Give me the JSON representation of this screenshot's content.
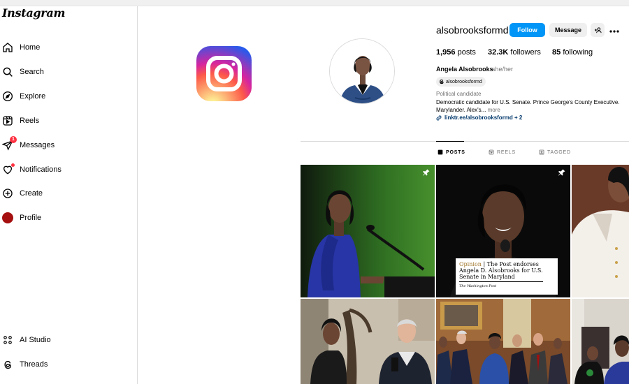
{
  "sidebar": {
    "brand": "Instagram",
    "items": [
      {
        "label": "Home",
        "icon": "home-icon"
      },
      {
        "label": "Search",
        "icon": "search-icon"
      },
      {
        "label": "Explore",
        "icon": "explore-icon"
      },
      {
        "label": "Reels",
        "icon": "reels-icon"
      },
      {
        "label": "Messages",
        "icon": "messages-icon",
        "badge": "1"
      },
      {
        "label": "Notifications",
        "icon": "heart-icon"
      },
      {
        "label": "Create",
        "icon": "create-icon"
      },
      {
        "label": "Profile",
        "icon": "avatar"
      }
    ],
    "bottom_items": [
      {
        "label": "AI Studio",
        "icon": "ai-studio-icon"
      },
      {
        "label": "Threads",
        "icon": "threads-icon"
      }
    ]
  },
  "profile": {
    "username": "alsobrooksformd",
    "follow_label": "Follow",
    "message_label": "Message",
    "stats": {
      "posts_count": "1,956",
      "posts_label": "posts",
      "followers_count": "32.3K",
      "followers_label": "followers",
      "following_count": "85",
      "following_label": "following"
    },
    "full_name": "Angela Alsobrooks",
    "pronouns": "she/her",
    "threads_handle": "alsobrooksformd",
    "category": "Political candidate",
    "bio_line1": "Democratic candidate for U.S. Senate. Prince George's County Executive.",
    "bio_line2": "Marylander. Alex's...",
    "bio_more": "more",
    "link_text": "linktr.ee/alsobrooksformd + 2"
  },
  "tabs": [
    {
      "label": "POSTS",
      "active": true
    },
    {
      "label": "REELS",
      "active": false
    },
    {
      "label": "TAGGED",
      "active": false
    }
  ],
  "posts": {
    "post2_caption_opinion": "Opinion",
    "post2_caption_sep": "|",
    "post2_caption_line1": "The Post endorses",
    "post2_caption_line2": "Angela D. Alsobrooks for U.S.",
    "post2_caption_line3": "Senate in Maryland",
    "post2_caption_source": "The Washington Post"
  },
  "colors": {
    "accent": "#0095f6",
    "notification_red": "#ff3040",
    "link": "#00376b"
  }
}
